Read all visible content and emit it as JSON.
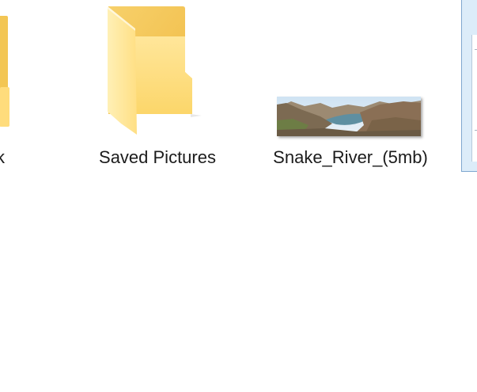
{
  "desktop": {
    "items": [
      {
        "label": "k",
        "type": "folder"
      },
      {
        "label": "Saved Pictures",
        "type": "folder"
      },
      {
        "label": "Snake_River_(5mb)",
        "type": "image"
      }
    ]
  },
  "colors": {
    "folder_front": "#FFE08A",
    "folder_back": "#F5C755",
    "window_border": "#7FA7CF",
    "window_bg": "#DCECF9"
  }
}
